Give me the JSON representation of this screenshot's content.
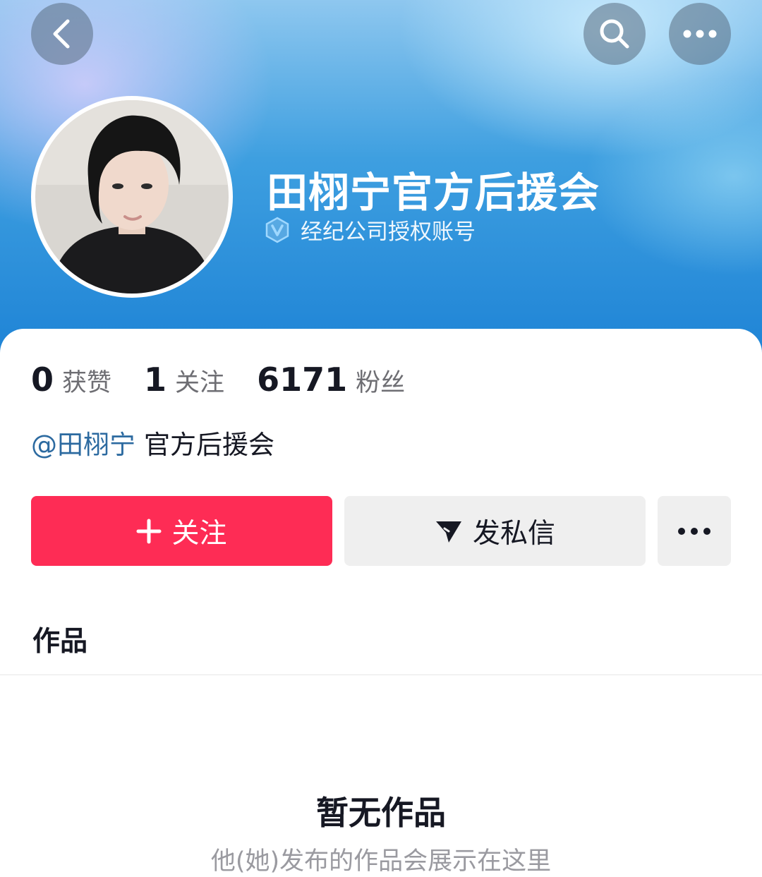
{
  "header": {
    "back_icon": "chevron-left-icon",
    "search_icon": "search-icon",
    "more_icon": "more-horizontal-icon",
    "title": "田栩宁官方后援会",
    "verified_label": "经纪公司授权账号",
    "verified_icon": "verified-v-icon"
  },
  "stats": [
    {
      "value": "0",
      "label": "获赞"
    },
    {
      "value": "1",
      "label": "关注"
    },
    {
      "value": "6171",
      "label": "粉丝"
    }
  ],
  "bio": {
    "mention": "@田栩宁",
    "text": "官方后援会"
  },
  "actions": {
    "follow_label": "关注",
    "message_label": "发私信"
  },
  "tabs": {
    "works_label": "作品"
  },
  "empty_state": {
    "title": "暂无作品",
    "subtitle": "他(她)发布的作品会展示在这里"
  },
  "colors": {
    "accent": "#fe2c55",
    "secondary_button": "#efefef",
    "mention": "#2c6aa0"
  }
}
